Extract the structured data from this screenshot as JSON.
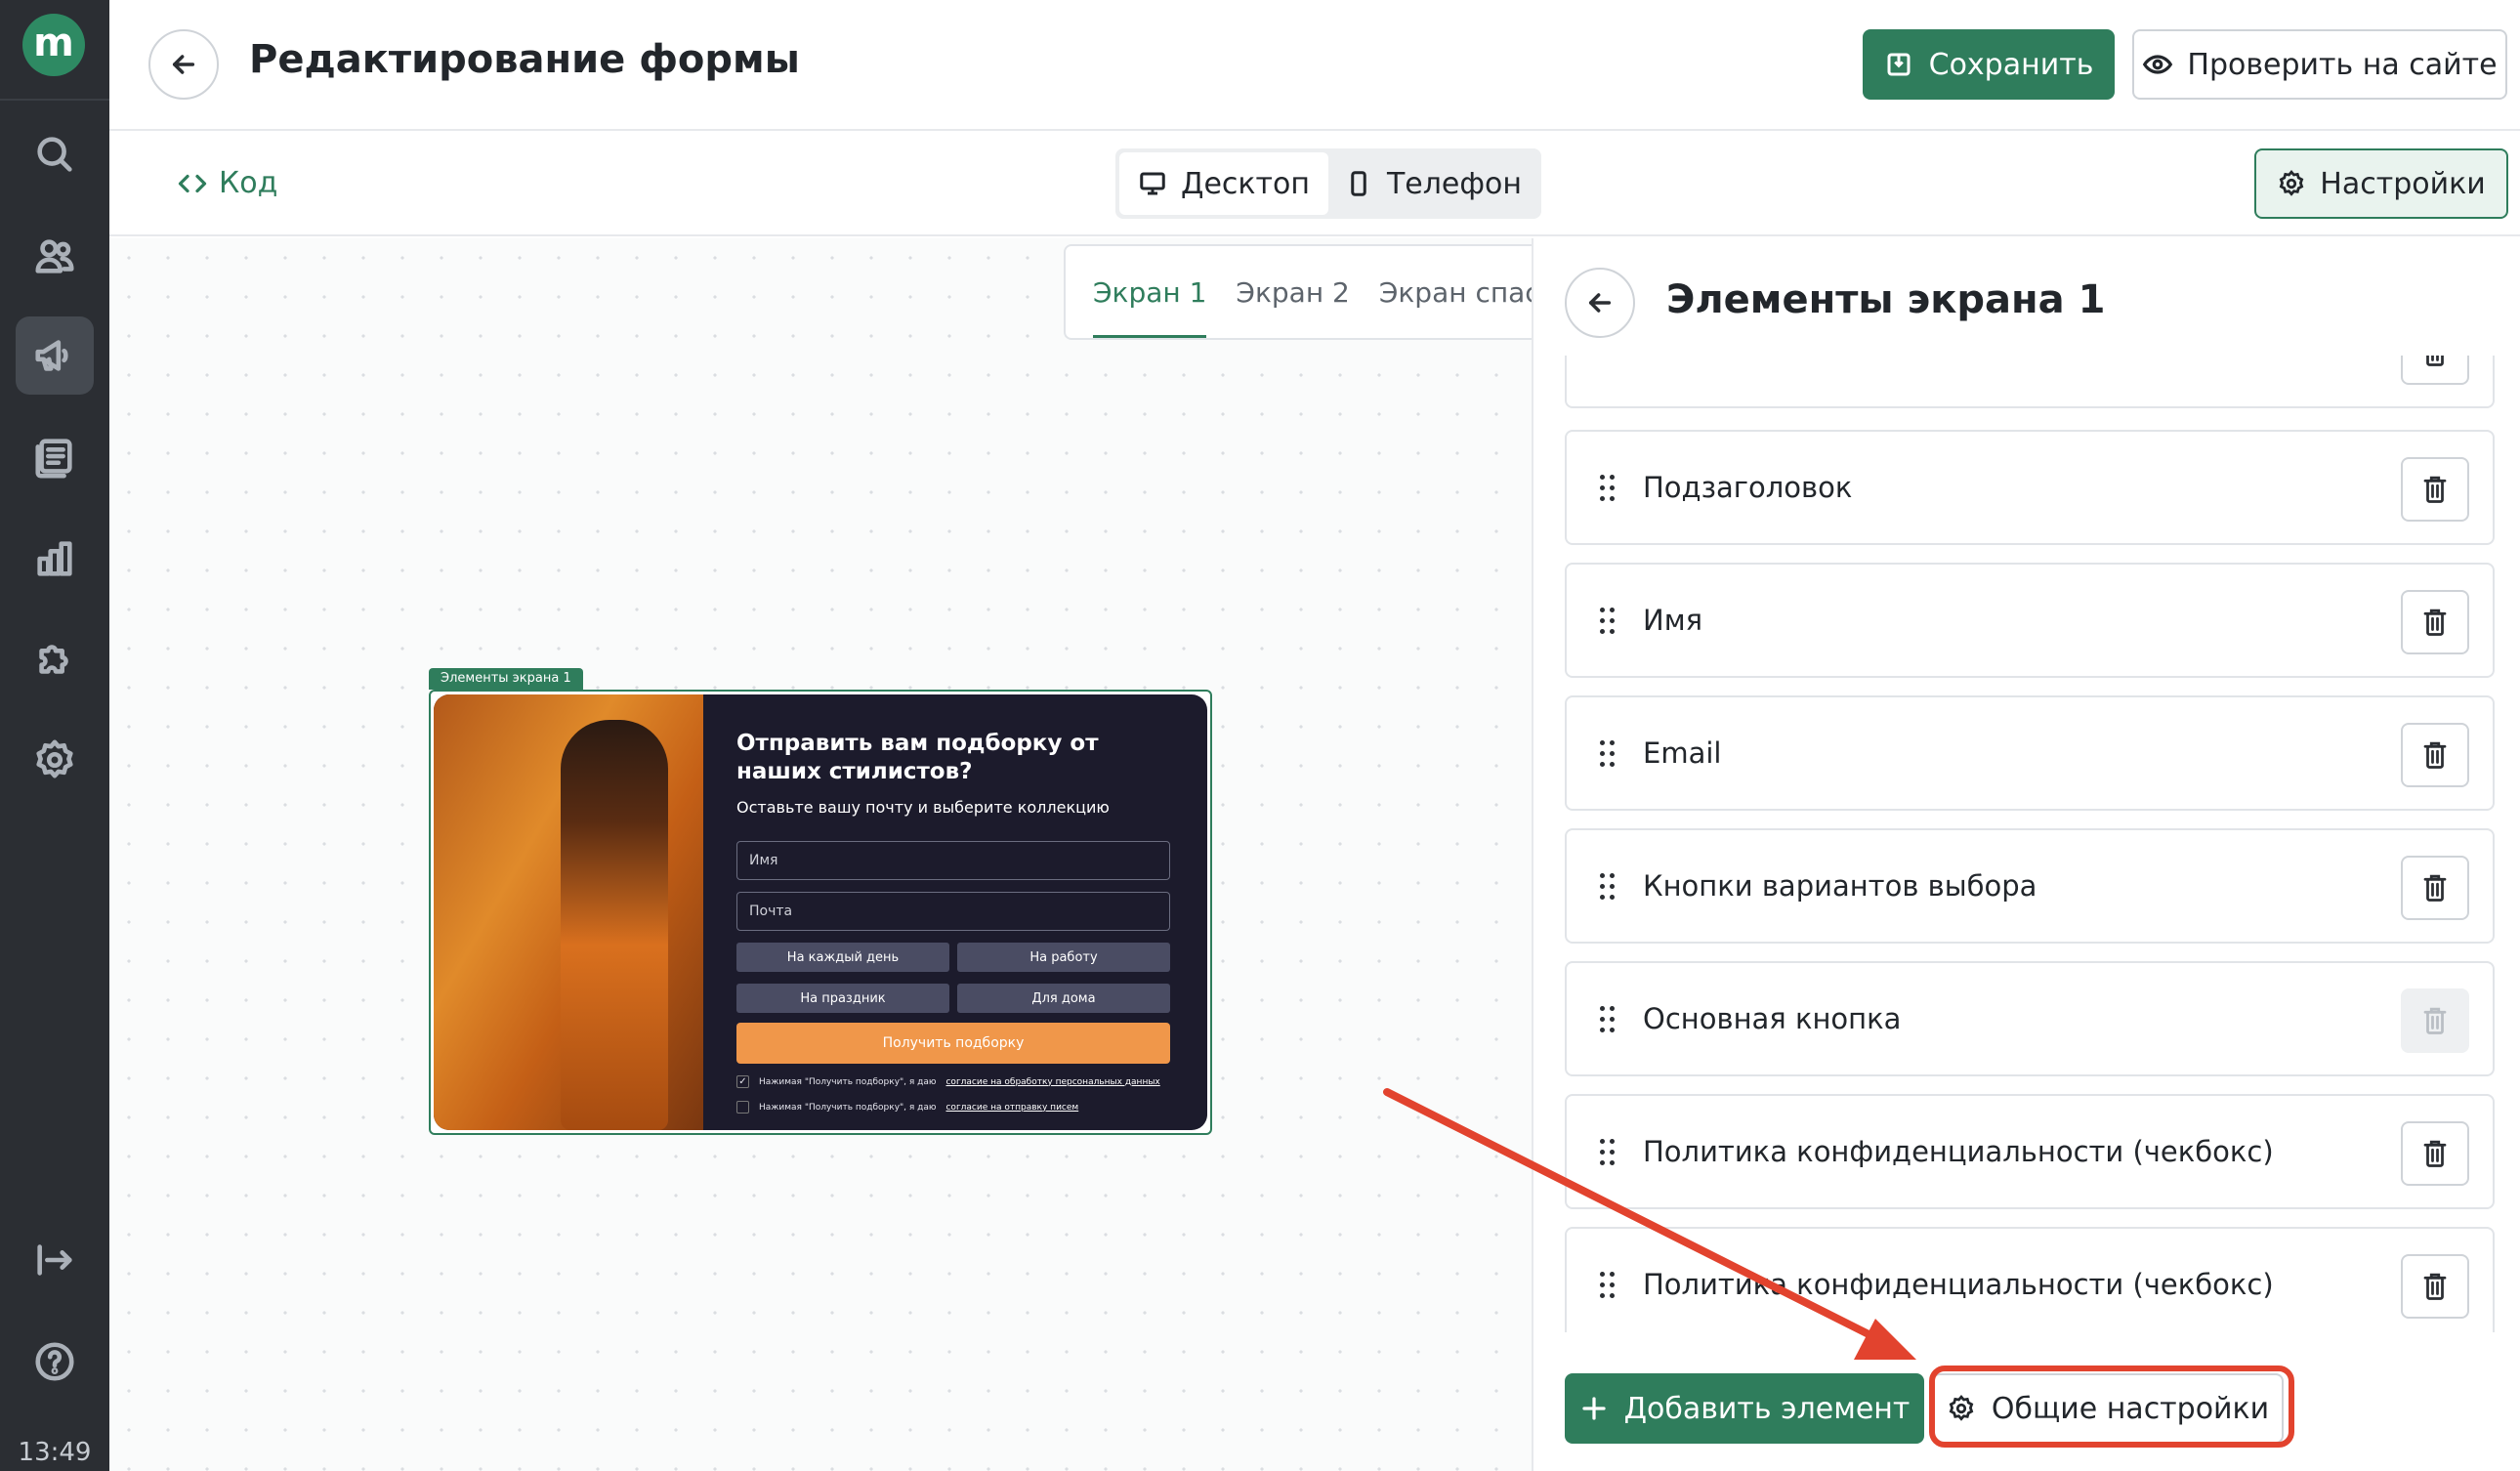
{
  "app": {
    "logo_letter": "m",
    "clock": "13:49"
  },
  "rail": {
    "icons": [
      "search-icon",
      "users-icon",
      "megaphone-icon",
      "list-icon",
      "chart-icon",
      "puzzle-icon",
      "settings-icon",
      "logout-icon",
      "help-icon"
    ]
  },
  "header": {
    "title": "Редактирование формы",
    "save_label": "Сохранить",
    "check_label": "Проверить на сайте"
  },
  "toolbar": {
    "code_label": "Код",
    "view_modes": [
      "Десктоп",
      "Телефон"
    ],
    "active_view": "Десктоп",
    "settings_label": "Настройки"
  },
  "canvas": {
    "tabs": [
      "Экран 1",
      "Экран 2",
      "Экран спаси"
    ],
    "active_tab": "Экран 1",
    "preview_label": "Элементы экрана 1",
    "form": {
      "title": "Отправить вам подборку от наших стилистов?",
      "subtitle": "Оставьте вашу почту и выберите коллекцию",
      "name_placeholder": "Имя",
      "email_placeholder": "Почта",
      "choices": [
        "На каждый день",
        "На работу",
        "На праздник",
        "Для дома"
      ],
      "submit_label": "Получить подборку",
      "consent1_text": "Нажимая \"Получить подборку\", я даю",
      "consent1_link": "согласие на обработку персональных данных",
      "consent2_text": "Нажимая \"Получить подборку\", я даю",
      "consent2_link": "согласие на отправку писем"
    }
  },
  "panel": {
    "title": "Элементы экрана 1",
    "items": [
      {
        "label": ""
      },
      {
        "label": "Подзаголовок"
      },
      {
        "label": "Имя"
      },
      {
        "label": "Email"
      },
      {
        "label": "Кнопки вариантов выбора"
      },
      {
        "label": "Основная кнопка"
      },
      {
        "label": "Политика конфиденциальности (чекбокс)"
      },
      {
        "label": "Политика конфиденциальности (чекбокс)"
      }
    ],
    "add_label": "Добавить элемент",
    "general_label": "Общие настройки"
  },
  "colors": {
    "accent": "#2f7d5c",
    "annotation": "#e2432e",
    "rail": "#2b2e33"
  }
}
